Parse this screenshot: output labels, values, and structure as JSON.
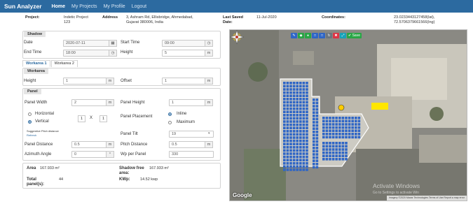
{
  "nav": {
    "brand": "Sun Analyzer",
    "links": [
      "Home",
      "My Projects",
      "My Profile",
      "Logout"
    ]
  },
  "project": {
    "project_label": "Project:",
    "project_value": "Indetic Project",
    "project_value2": "123",
    "address_label": "Address",
    "address_line1": "3, Ashram Rd, Ellisbridge, Ahmedabad,",
    "address_line2": "Gujarat 380006, India",
    "last_saved_label": "Last Saved",
    "last_saved_label2": "Date:",
    "last_saved_value": "11-Jul-2020",
    "coordinates_label": "Coordinates:",
    "coordinates_lat": "23.0233443127458(lat),",
    "coordinates_lng": "72.5706379661566(lng)"
  },
  "shadow": {
    "title": "Shadow",
    "date_label": "Date",
    "date_value": "2020-07-11",
    "start_time_label": "Start Time",
    "start_time_value": "09:00",
    "end_time_label": "End Time",
    "end_time_value": "18:00",
    "height_label": "Height",
    "height_value": "5",
    "height_unit": "m"
  },
  "tabs": [
    "Workarea 1",
    "Workarea 2"
  ],
  "workarea": {
    "title": "Workarea",
    "height_label": "Height",
    "height_value": "1",
    "height_unit": "m",
    "offset_label": "Offset",
    "offset_value": "1",
    "offset_unit": "m"
  },
  "panel": {
    "title": "Panel",
    "width_label": "Panel Width",
    "width_value": "2",
    "width_unit": "m",
    "height_label": "Panel Height",
    "height_value": "1",
    "height_unit": "m",
    "orientation_horizontal": "Horizontal",
    "orientation_vertical": "Vertical",
    "grid_cols": "1",
    "grid_x": "X",
    "grid_rows": "1",
    "placement_label": "Panel Placement",
    "placement_inline": "Inline",
    "placement_maximum": "Maximum",
    "suggest_text": "Suggestive Pitch distance",
    "refresh_text": "Refresh",
    "tilt_label": "Panel Tilt",
    "tilt_value": "19",
    "distance_label": "Panel Distance",
    "distance_value": "0.5",
    "distance_unit": "m",
    "pitch_label": "Pitch Distance",
    "pitch_value": "0.5",
    "pitch_unit": "m",
    "azimuth_label": "Azimuth Angle",
    "azimuth_value": "0",
    "azimuth_unit": "°",
    "wp_label": "Wp per Panel",
    "wp_value": "330"
  },
  "summary": {
    "area_label": "Area",
    "area_value": "167.933 m²",
    "shadow_free_label": "Shadow free",
    "shadow_free_label2": "area:",
    "shadow_free_value": "167.933 m²",
    "total_label": "Total",
    "total_label2": "panel(s):",
    "total_value": "44",
    "kwp_label": "KWp:",
    "kwp_value": "14.52 kwp"
  },
  "map": {
    "toolbar_icons": [
      "edit-icon",
      "fill-icon",
      "dropper-icon",
      "square-icon",
      "square-icon",
      "refresh-icon",
      "delete-icon",
      "expand-icon"
    ],
    "save_label": "Save",
    "google_label": "Google",
    "attribution": "Imagery ©2020 Maxar Technologies   Terms of Use   Report a map error",
    "colors": {
      "panel": "#2f66c6",
      "outline": "#ffffff",
      "highlight": "#ffe600",
      "navbar": "#2c6aa0"
    }
  },
  "watermark": {
    "line1": "Activate Windows",
    "line2": "Go to Settings to activate Win"
  }
}
